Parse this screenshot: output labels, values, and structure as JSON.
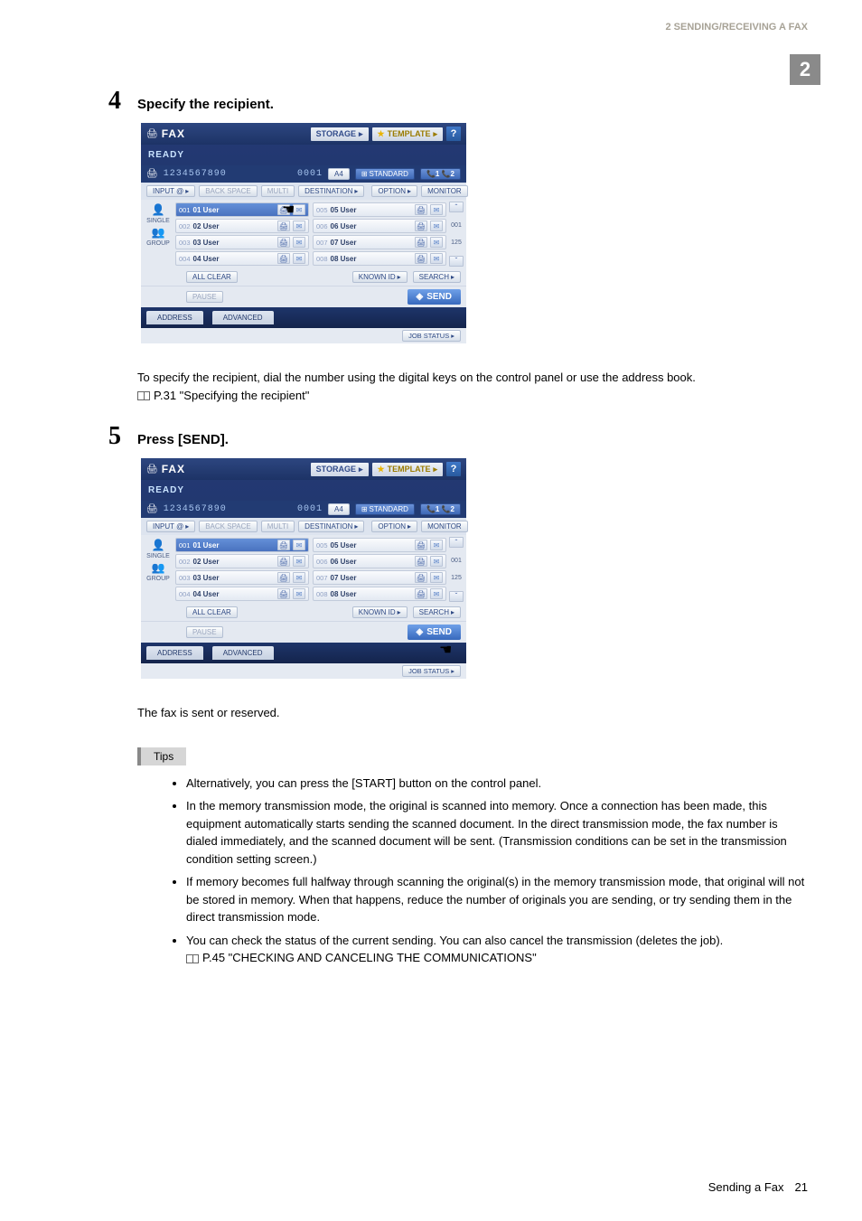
{
  "header": {
    "chapter_title": "2 SENDING/RECEIVING A FAX",
    "side_tab": "2"
  },
  "steps": {
    "s4": {
      "num": "4",
      "title": "Specify the recipient.",
      "desc": "To specify the recipient, dial the number using the digital keys on the control panel or use the address book.",
      "ref": "P.31 \"Specifying the recipient\""
    },
    "s5": {
      "num": "5",
      "title": "Press [SEND].",
      "after": "The fax is sent or reserved."
    }
  },
  "fax": {
    "title": "FAX",
    "storage": "STORAGE",
    "template": "TEMPLATE",
    "help": "?",
    "ready": "READY",
    "number": "1234567890",
    "seq": "0001",
    "paper": "A4",
    "standard": "STANDARD",
    "lines": "1 2",
    "toolbar": {
      "input": "INPUT @",
      "backspace": "BACK SPACE",
      "multi": "MULTI",
      "destination": "DESTINATION",
      "option": "OPTION",
      "monitor": "MONITOR"
    },
    "left1": {
      "icon": "👤",
      "label": "SINGLE"
    },
    "left2": {
      "icon": "👥",
      "label": "GROUP"
    },
    "list": {
      "colA": [
        {
          "idx": "001",
          "name": "01 User",
          "selected": true
        },
        {
          "idx": "002",
          "name": "02 User",
          "selected": false
        },
        {
          "idx": "003",
          "name": "03 User",
          "selected": false
        },
        {
          "idx": "004",
          "name": "04 User",
          "selected": false
        }
      ],
      "colB": [
        {
          "idx": "005",
          "name": "05 User"
        },
        {
          "idx": "006",
          "name": "06 User"
        },
        {
          "idx": "007",
          "name": "07 User"
        },
        {
          "idx": "008",
          "name": "08 User"
        }
      ],
      "scroll": {
        "pos": "001",
        "total": "125"
      }
    },
    "below": {
      "allclear": "ALL CLEAR",
      "knownid": "KNOWN ID",
      "search": "SEARCH",
      "pause": "PAUSE",
      "send": "SEND"
    },
    "tabs": {
      "address": "ADDRESS",
      "advanced": "ADVANCED"
    },
    "jobstatus": "JOB STATUS"
  },
  "tips": {
    "label": "Tips",
    "items": [
      "Alternatively, you can press the [START] button on the control panel.",
      "In the memory transmission mode, the original is scanned into memory. Once a connection has been made, this equipment automatically starts sending the scanned document. In the direct transmission mode, the fax number is dialed immediately, and the scanned document will be sent. (Transmission conditions can be set in the transmission condition setting screen.)",
      "If memory becomes full halfway through scanning the original(s) in the memory transmission mode, that original will not be stored in memory. When that happens, reduce the number of originals you are sending, or try sending them in the direct transmission mode.",
      "You can check the status of the current sending. You can also cancel the transmission (deletes the job)."
    ],
    "ref": "P.45 \"CHECKING AND CANCELING THE COMMUNICATIONS\""
  },
  "footer": {
    "title": "Sending a Fax",
    "page": "21"
  }
}
